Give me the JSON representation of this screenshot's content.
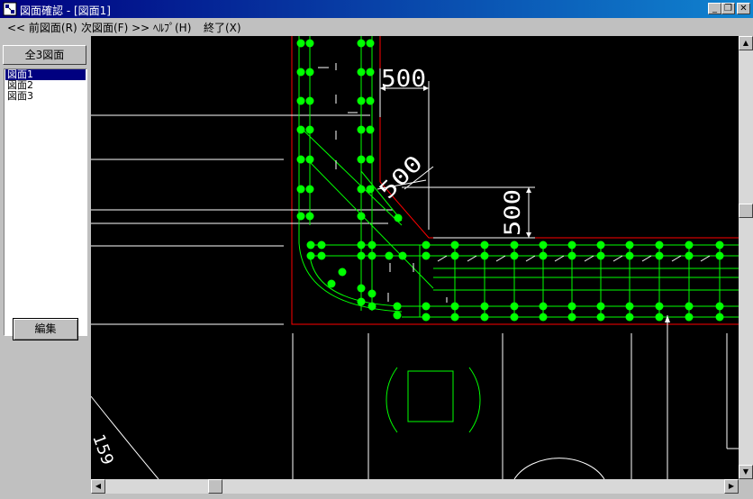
{
  "window": {
    "title": "図面確認 - [図面1]",
    "minimize_glyph": "_",
    "restore_glyph": "❐",
    "close_glyph": "✕"
  },
  "menu": {
    "items": [
      {
        "label": "<< 前図面(R)"
      },
      {
        "label": "次図面(F) >>"
      },
      {
        "label": "ﾍﾙﾌﾟ(H)"
      },
      {
        "label": "終了(X)"
      }
    ]
  },
  "sidebar": {
    "total_label": "全3図面",
    "sheets": [
      {
        "label": "図面1",
        "selected": true
      },
      {
        "label": "図面2",
        "selected": false
      },
      {
        "label": "図面3",
        "selected": false
      }
    ],
    "edit_label": "編集"
  },
  "drawing": {
    "dimension_top": "500",
    "dimension_diagonal": "500",
    "dimension_right": "500",
    "label_bottom_left": "159",
    "colors": {
      "background": "#000000",
      "rebar": "#00ff00",
      "outline": "#ff0000",
      "lines": "#ffffff"
    }
  }
}
